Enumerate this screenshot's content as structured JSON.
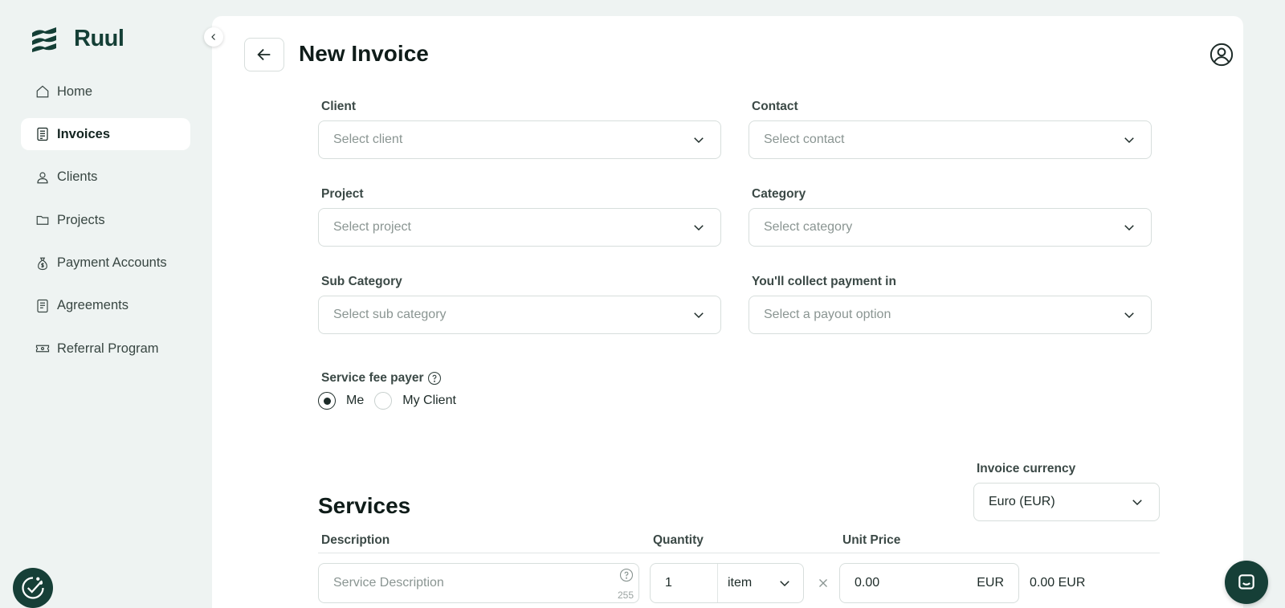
{
  "app": {
    "brand": "Ruul"
  },
  "sidebar": {
    "items": [
      {
        "label": "Home",
        "icon": "home-icon",
        "active": false
      },
      {
        "label": "Invoices",
        "icon": "invoice-icon",
        "active": true
      },
      {
        "label": "Clients",
        "icon": "user-icon",
        "active": false
      },
      {
        "label": "Projects",
        "icon": "folder-icon",
        "active": false
      },
      {
        "label": "Payment Accounts",
        "icon": "money-bag-icon",
        "active": false
      },
      {
        "label": "Agreements",
        "icon": "document-icon",
        "active": false
      },
      {
        "label": "Referral Program",
        "icon": "ticket-icon",
        "active": false
      }
    ]
  },
  "header": {
    "title": "New Invoice"
  },
  "form": {
    "client": {
      "label": "Client",
      "placeholder": "Select client"
    },
    "contact": {
      "label": "Contact",
      "placeholder": "Select contact"
    },
    "project": {
      "label": "Project",
      "placeholder": "Select project"
    },
    "category": {
      "label": "Category",
      "placeholder": "Select category"
    },
    "sub_category": {
      "label": "Sub Category",
      "placeholder": "Select sub category"
    },
    "payout": {
      "label": "You'll collect payment in",
      "placeholder": "Select a payout option"
    },
    "fee_payer": {
      "label": "Service fee payer",
      "options": [
        "Me",
        "My Client"
      ],
      "selected": "Me"
    },
    "currency": {
      "label": "Invoice currency",
      "value": "Euro (EUR)"
    }
  },
  "services": {
    "title": "Services",
    "columns": {
      "description": "Description",
      "quantity": "Quantity",
      "unit_price": "Unit Price"
    },
    "row": {
      "description_placeholder": "Service Description",
      "char_limit": "255",
      "quantity": "1",
      "unit": "item",
      "price": "0.00",
      "price_currency": "EUR",
      "total": "0.00 EUR"
    }
  },
  "colors": {
    "brand": "#163f37",
    "active_bg": "#ffffff",
    "sidebar_bg": "#eef3f2"
  }
}
